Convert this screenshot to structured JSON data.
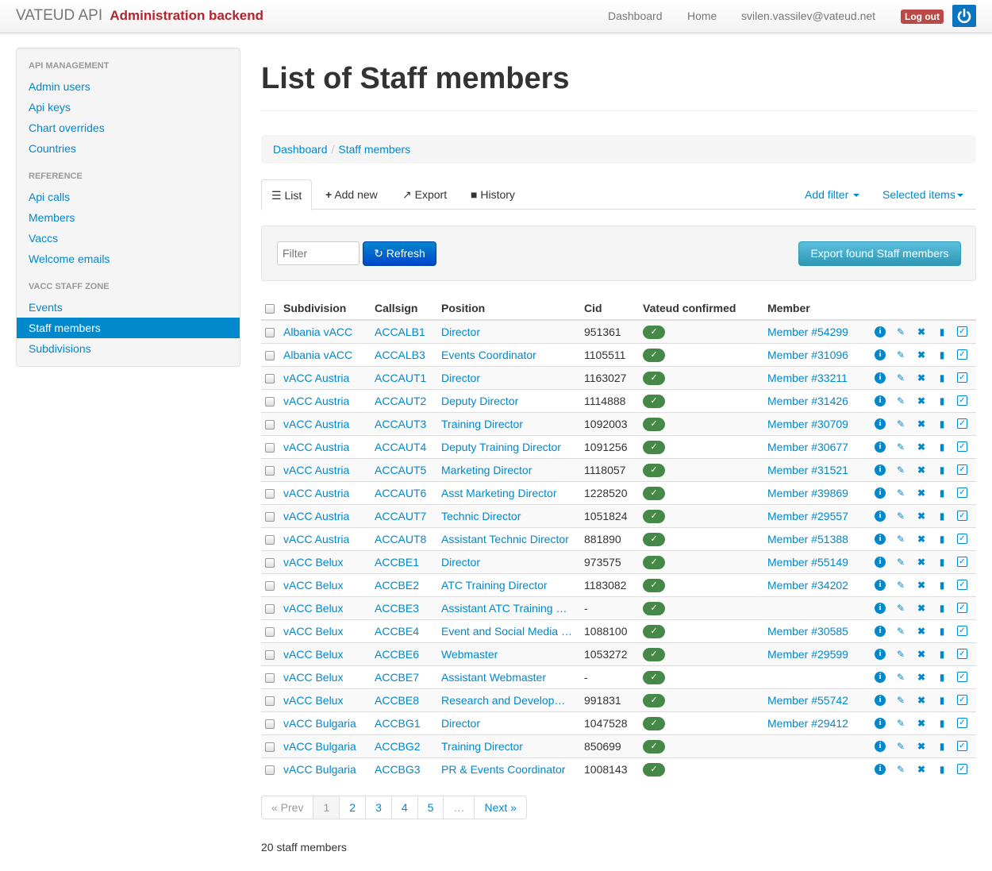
{
  "navbar": {
    "brand": "VATEUD API",
    "brand_sub": "Administration backend",
    "links": {
      "dashboard": "Dashboard",
      "home": "Home",
      "user": "svilen.vassilev@vateud.net",
      "logout": "Log out"
    }
  },
  "sidebar": {
    "sections": [
      {
        "header": "API MANAGEMENT",
        "items": [
          "Admin users",
          "Api keys",
          "Chart overrides",
          "Countries"
        ]
      },
      {
        "header": "REFERENCE",
        "items": [
          "Api calls",
          "Members",
          "Vaccs",
          "Welcome emails"
        ]
      },
      {
        "header": "VACC STAFF ZONE",
        "items": [
          "Events",
          "Staff members",
          "Subdivisions"
        ]
      }
    ],
    "active": "Staff members"
  },
  "page": {
    "title": "List of Staff members",
    "breadcrumb": [
      "Dashboard",
      "Staff members"
    ]
  },
  "tabs": {
    "list": "List",
    "add_new": "Add new",
    "export": "Export",
    "history": "History",
    "add_filter": "Add filter",
    "selected_items": "Selected items"
  },
  "filter": {
    "placeholder": "Filter",
    "refresh": "Refresh",
    "export_found": "Export found Staff members"
  },
  "table": {
    "headers": {
      "subdivision": "Subdivision",
      "callsign": "Callsign",
      "position": "Position",
      "cid": "Cid",
      "confirmed": "Vateud confirmed",
      "member": "Member"
    },
    "rows": [
      {
        "subdivision": "Albania vACC",
        "callsign": "ACCALB1",
        "position": "Director",
        "cid": "951361",
        "member": "Member #54299"
      },
      {
        "subdivision": "Albania vACC",
        "callsign": "ACCALB3",
        "position": "Events Coordinator",
        "cid": "1105511",
        "member": "Member #31096"
      },
      {
        "subdivision": "vACC Austria",
        "callsign": "ACCAUT1",
        "position": "Director",
        "cid": "1163027",
        "member": "Member #33211"
      },
      {
        "subdivision": "vACC Austria",
        "callsign": "ACCAUT2",
        "position": "Deputy Director",
        "cid": "1114888",
        "member": "Member #31426"
      },
      {
        "subdivision": "vACC Austria",
        "callsign": "ACCAUT3",
        "position": "Training Director",
        "cid": "1092003",
        "member": "Member #30709"
      },
      {
        "subdivision": "vACC Austria",
        "callsign": "ACCAUT4",
        "position": "Deputy Training Director",
        "cid": "1091256",
        "member": "Member #30677"
      },
      {
        "subdivision": "vACC Austria",
        "callsign": "ACCAUT5",
        "position": "Marketing Director",
        "cid": "1118057",
        "member": "Member #31521"
      },
      {
        "subdivision": "vACC Austria",
        "callsign": "ACCAUT6",
        "position": "Asst Marketing Director",
        "cid": "1228520",
        "member": "Member #39869"
      },
      {
        "subdivision": "vACC Austria",
        "callsign": "ACCAUT7",
        "position": "Technic Director",
        "cid": "1051824",
        "member": "Member #29557"
      },
      {
        "subdivision": "vACC Austria",
        "callsign": "ACCAUT8",
        "position": "Assistant Technic Director",
        "cid": "881890",
        "member": "Member #51388"
      },
      {
        "subdivision": "vACC Belux",
        "callsign": "ACCBE1",
        "position": "Director",
        "cid": "973575",
        "member": "Member #55149"
      },
      {
        "subdivision": "vACC Belux",
        "callsign": "ACCBE2",
        "position": "ATC Training Director",
        "cid": "1183082",
        "member": "Member #34202"
      },
      {
        "subdivision": "vACC Belux",
        "callsign": "ACCBE3",
        "position": "Assistant ATC Training …",
        "cid": "-",
        "member": ""
      },
      {
        "subdivision": "vACC Belux",
        "callsign": "ACCBE4",
        "position": "Event and Social Media …",
        "cid": "1088100",
        "member": "Member #30585"
      },
      {
        "subdivision": "vACC Belux",
        "callsign": "ACCBE6",
        "position": "Webmaster",
        "cid": "1053272",
        "member": "Member #29599"
      },
      {
        "subdivision": "vACC Belux",
        "callsign": "ACCBE7",
        "position": "Assistant Webmaster",
        "cid": "-",
        "member": ""
      },
      {
        "subdivision": "vACC Belux",
        "callsign": "ACCBE8",
        "position": "Research and Develop…",
        "cid": "991831",
        "member": "Member #55742"
      },
      {
        "subdivision": "vACC Bulgaria",
        "callsign": "ACCBG1",
        "position": "Director",
        "cid": "1047528",
        "member": "Member #29412"
      },
      {
        "subdivision": "vACC Bulgaria",
        "callsign": "ACCBG2",
        "position": "Training Director",
        "cid": "850699",
        "member": ""
      },
      {
        "subdivision": "vACC Bulgaria",
        "callsign": "ACCBG3",
        "position": "PR & Events Coordinator",
        "cid": "1008143",
        "member": ""
      }
    ]
  },
  "pagination": [
    "« Prev",
    "1",
    "2",
    "3",
    "4",
    "5",
    "…",
    "Next »"
  ],
  "footer": {
    "count": "20 staff members"
  },
  "colors": {
    "link": "#0088cc",
    "brand_sub": "#b0262e",
    "confirmed_badge": "#468847",
    "logout": "#b94a48",
    "active_item": "#0088cc"
  }
}
